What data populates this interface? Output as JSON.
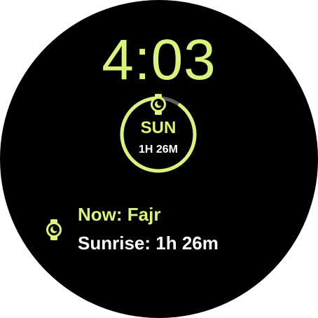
{
  "colors": {
    "background": "#000000",
    "accent": "#D9F47A",
    "text": "#FFFFFF",
    "track": "#5F5F5F"
  },
  "clock": {
    "time": "4:03"
  },
  "day_complication": {
    "day": "SUN",
    "countdown": "1H 26M",
    "icon": "watch-moon-icon",
    "progress": 0.9
  },
  "prayer_complication": {
    "icon": "watch-moon-icon",
    "current": "Now: Fajr",
    "next": "Sunrise: 1h 26m"
  }
}
